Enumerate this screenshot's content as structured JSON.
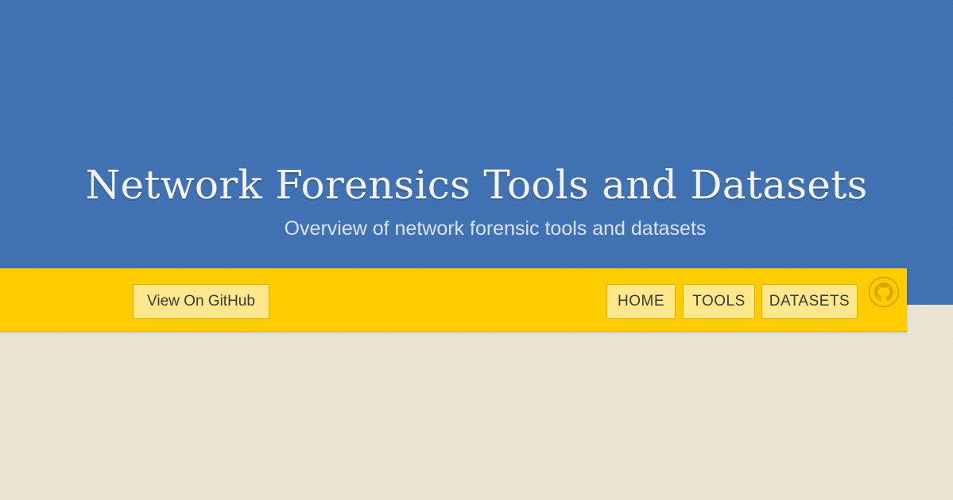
{
  "header": {
    "title": "Network Forensics Tools and Datasets",
    "subtitle": "Overview of network forensic tools and datasets"
  },
  "navbar": {
    "github_label": "View On GitHub",
    "links": [
      {
        "label": "HOME"
      },
      {
        "label": "TOOLS"
      },
      {
        "label": "DATASETS"
      }
    ],
    "icon": "github-octocat-icon"
  },
  "colors": {
    "hero_background": "#3f71b2",
    "navbar_background": "#ffcc00",
    "button_background": "#ffe88c",
    "page_background": "#e8e3cf",
    "octocat": "#d8aa00"
  }
}
